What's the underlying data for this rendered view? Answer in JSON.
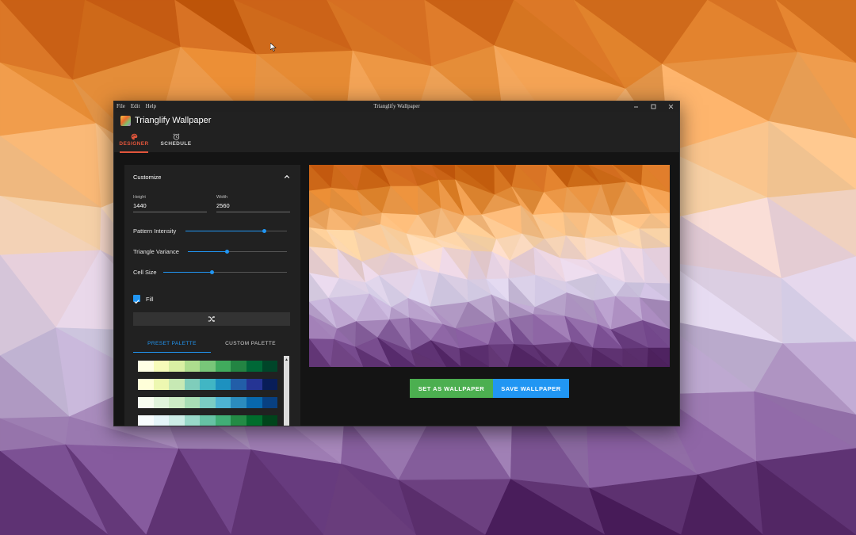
{
  "window": {
    "title": "Trianglify Wallpaper",
    "menu": [
      "File",
      "Edit",
      "Help"
    ]
  },
  "app": {
    "title": "Trianglify Wallpaper",
    "tabs": [
      {
        "label": "DESIGNER",
        "icon": "palette-icon",
        "active": true
      },
      {
        "label": "SCHEDULE",
        "icon": "alarm-clock-icon",
        "active": false
      }
    ]
  },
  "customize": {
    "title": "Customize",
    "height": {
      "label": "Height",
      "value": "1440"
    },
    "width": {
      "label": "Width",
      "value": "2560"
    },
    "sliders": [
      {
        "label": "Pattern Intensity",
        "value": 0.77
      },
      {
        "label": "Triangle Variance",
        "value": 0.39
      },
      {
        "label": "Cell Size",
        "value": 0.39
      }
    ],
    "fill": {
      "label": "Fill",
      "checked": true
    },
    "shuffle_icon": "shuffle-icon",
    "palette_tabs": [
      {
        "label": "PRESET PALETTE",
        "active": true
      },
      {
        "label": "CUSTOM PALETTE",
        "active": false
      }
    ],
    "palettes": [
      [
        "#ffffe5",
        "#f7fcb9",
        "#d9f0a3",
        "#addd8e",
        "#78c679",
        "#41ab5d",
        "#238443",
        "#006837",
        "#004529"
      ],
      [
        "#ffffd9",
        "#edf8b1",
        "#c7e9b4",
        "#7fcdbb",
        "#41b6c4",
        "#1d91c0",
        "#225ea8",
        "#253494",
        "#081d58"
      ],
      [
        "#f7fcf0",
        "#e0f3db",
        "#ccebc5",
        "#a8ddb5",
        "#7bccc4",
        "#4eb3d3",
        "#2b8cbe",
        "#0868ac",
        "#084081"
      ],
      [
        "#f7fcfd",
        "#e5f5f9",
        "#ccece6",
        "#99d8c9",
        "#66c2a4",
        "#41ae76",
        "#238b45",
        "#006d2c",
        "#00441b"
      ]
    ]
  },
  "actions": {
    "set_label": "SET AS WALLPAPER",
    "save_label": "SAVE WALLPAPER"
  },
  "colors": {
    "accent_orange": "#e2553b",
    "accent_blue": "#2196f3",
    "green_button": "#4caf50",
    "wallpaper_palette": [
      "#c2570f",
      "#e0832a",
      "#f5b06b",
      "#fad4a8",
      "#e9d3e2",
      "#d7cfe8",
      "#a98dbd",
      "#7a4e92",
      "#4a1e5a"
    ]
  }
}
